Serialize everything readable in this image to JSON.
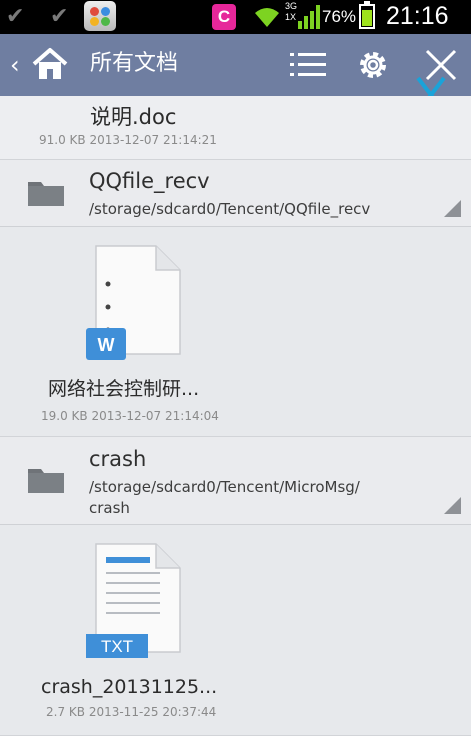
{
  "status_bar": {
    "battery_percent": "76%",
    "battery_level": 0.76,
    "time": "21:16",
    "network_label_top": "3G",
    "network_label_bottom": "1X",
    "app_badge_letter": "C",
    "icons": [
      "check-icon",
      "check-icon",
      "app-store-icon",
      "notification-c-icon",
      "wifi-icon",
      "signal-icon",
      "battery-icon"
    ]
  },
  "action_bar": {
    "title": "所有文档",
    "icons": [
      "back-chevron-icon",
      "home-icon",
      "list-menu-icon",
      "gear-icon",
      "close-icon",
      "scissors-icon"
    ],
    "accent_color": "#6f7ea1"
  },
  "files": {
    "top_item": {
      "name": "说明.doc",
      "meta": "91.0 KB  2013-12-07 21:14:21"
    },
    "groups": [
      {
        "folder_name": "QQfile_recv",
        "path": "/storage/sdcard0/Tencent/QQfile_recv",
        "items": [
          {
            "icon": "word-document-icon",
            "badge": "W",
            "name": "网络社会控制研...",
            "meta": "19.0 KB  2013-12-07 21:14:04"
          }
        ]
      },
      {
        "folder_name": "crash",
        "path_line1": "/storage/sdcard0/Tencent/MicroMsg/",
        "path_line2": "crash",
        "items": [
          {
            "icon": "txt-document-icon",
            "badge": "TXT",
            "name": "crash_20131125...",
            "meta": "2.7 KB  2013-11-25 20:37:44"
          }
        ]
      }
    ]
  }
}
